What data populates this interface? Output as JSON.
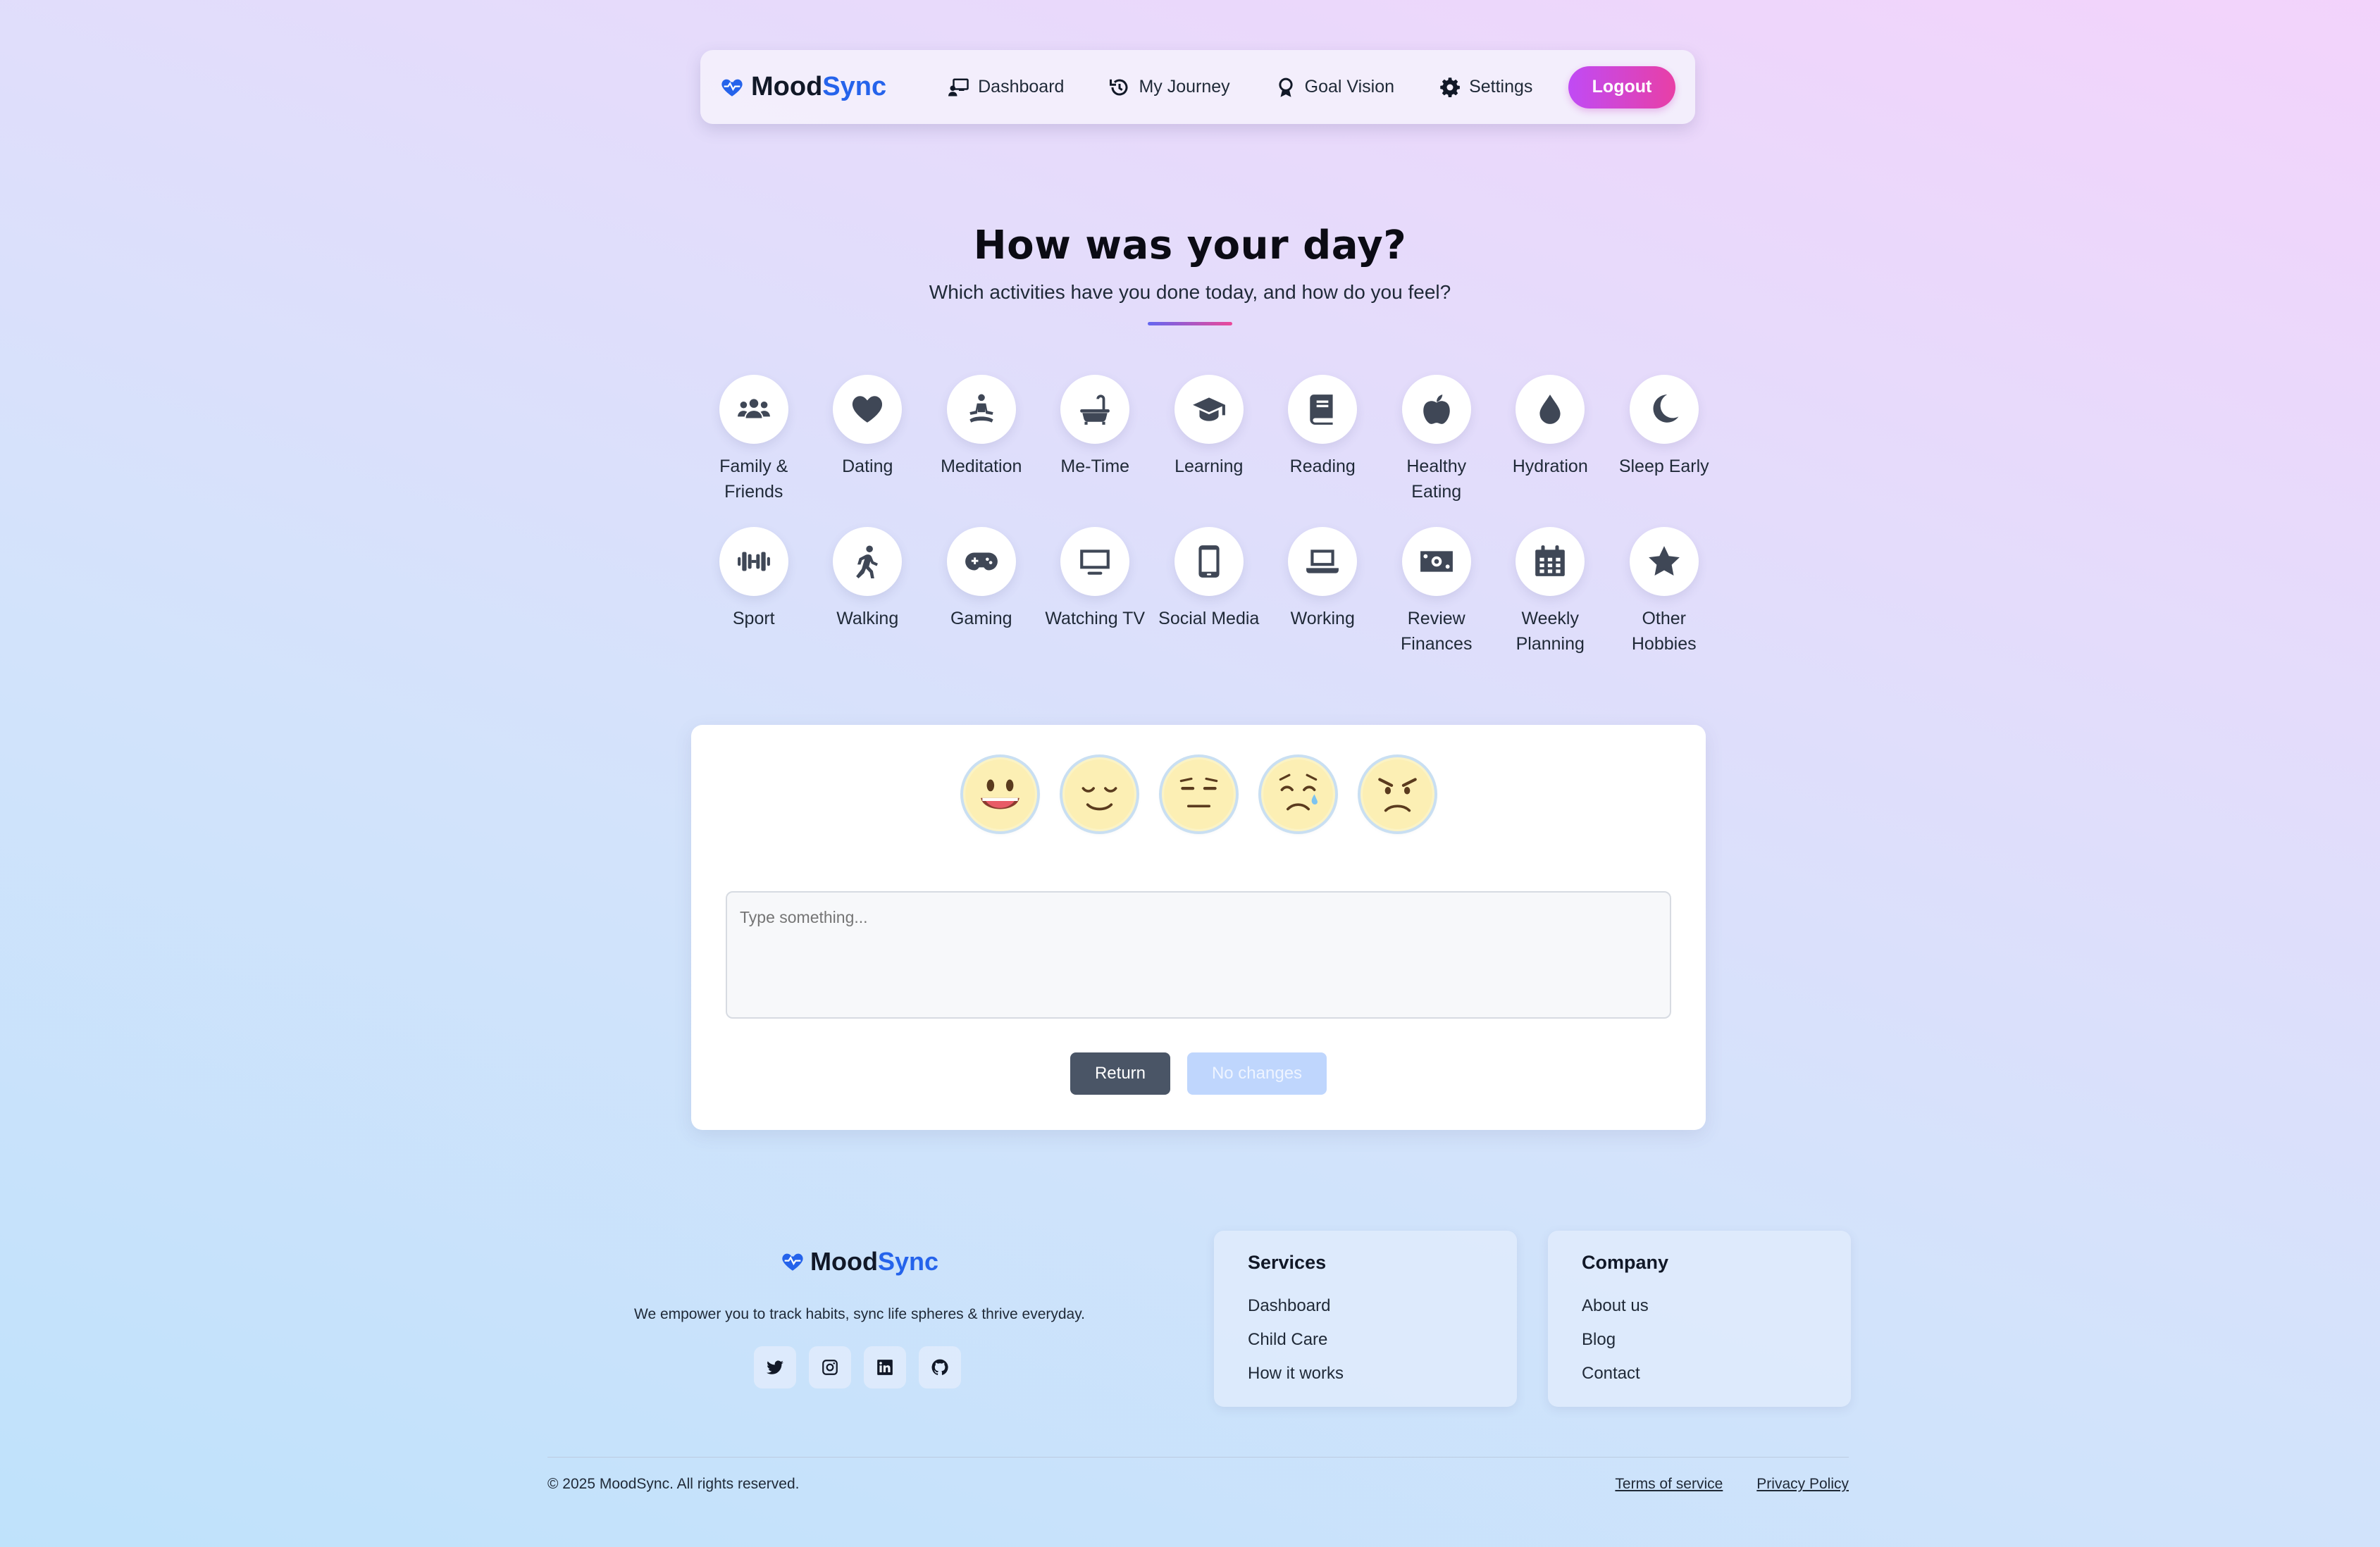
{
  "nav": {
    "brand_part1": "Mood",
    "brand_part2": "Sync",
    "brand_icon": "heart-pulse-icon",
    "links": [
      {
        "label": "Dashboard",
        "icon": "chalkboard-user-icon"
      },
      {
        "label": "My Journey",
        "icon": "history-icon"
      },
      {
        "label": "Goal Vision",
        "icon": "award-icon"
      },
      {
        "label": "Settings",
        "icon": "gear-icon"
      }
    ],
    "logout_label": "Logout"
  },
  "hero": {
    "title": "How was your day?",
    "subtitle": "Which activities have you done today, and how do you feel?"
  },
  "activities": [
    {
      "label": "Family & Friends",
      "icon": "users-icon"
    },
    {
      "label": "Dating",
      "icon": "heart-icon"
    },
    {
      "label": "Meditation",
      "icon": "meditation-icon"
    },
    {
      "label": "Me-Time",
      "icon": "bath-icon"
    },
    {
      "label": "Learning",
      "icon": "graduation-cap-icon"
    },
    {
      "label": "Reading",
      "icon": "book-icon"
    },
    {
      "label": "Healthy Eating",
      "icon": "apple-icon"
    },
    {
      "label": "Hydration",
      "icon": "droplet-icon"
    },
    {
      "label": "Sleep Early",
      "icon": "moon-icon"
    },
    {
      "label": "Sport",
      "icon": "dumbbell-icon"
    },
    {
      "label": "Walking",
      "icon": "walking-icon"
    },
    {
      "label": "Gaming",
      "icon": "gamepad-icon"
    },
    {
      "label": "Watching TV",
      "icon": "tv-icon"
    },
    {
      "label": "Social Media",
      "icon": "mobile-icon"
    },
    {
      "label": "Working",
      "icon": "laptop-icon"
    },
    {
      "label": "Review Finances",
      "icon": "money-bill-icon"
    },
    {
      "label": "Weekly Planning",
      "icon": "calendar-icon"
    },
    {
      "label": "Other Hobbies",
      "icon": "star-icon"
    }
  ],
  "moods": [
    "very-happy-emoji-icon",
    "content-emoji-icon",
    "neutral-emoji-icon",
    "sad-emoji-icon",
    "angry-emoji-icon"
  ],
  "note": {
    "placeholder": "Type something..."
  },
  "buttons": {
    "return_label": "Return",
    "save_label": "No changes"
  },
  "footer": {
    "brand_part1": "Mood",
    "brand_part2": "Sync",
    "tagline": "We empower you to track habits, sync life spheres & thrive everyday.",
    "socials": [
      "twitter-icon",
      "instagram-icon",
      "linkedin-icon",
      "github-icon"
    ],
    "services": {
      "title": "Services",
      "links": [
        "Dashboard",
        "Child Care",
        "How it works"
      ]
    },
    "company": {
      "title": "Company",
      "links": [
        "About us",
        "Blog",
        "Contact"
      ]
    },
    "copyright": "© 2025 MoodSync. All rights reserved.",
    "legal": [
      "Terms of service",
      "Privacy Policy"
    ]
  },
  "colors": {
    "accent": "#2563eb",
    "logout_start": "#c04bf5",
    "logout_end": "#e83fa6",
    "icon": "#3f4756"
  }
}
